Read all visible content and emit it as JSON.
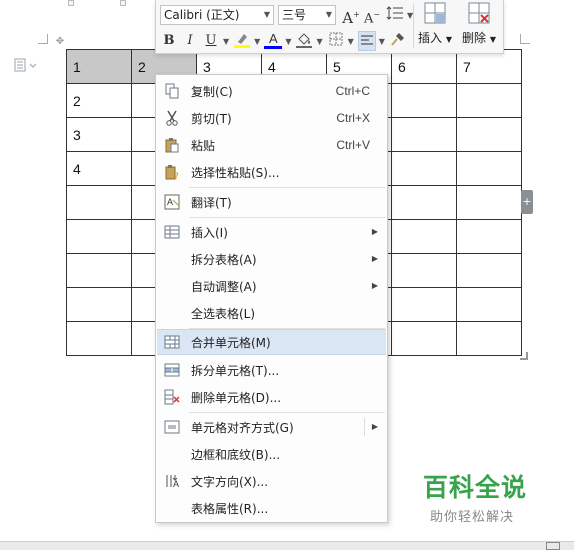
{
  "toolbar": {
    "font_name": "Calibri (正文)",
    "font_size": "三号",
    "grow_font": "A",
    "shrink_font": "A",
    "bold": "B",
    "italic": "I",
    "underline": "U",
    "font_color": "A",
    "insert_label": "插入",
    "delete_label": "删除"
  },
  "table": {
    "rows": [
      [
        "1",
        "2",
        "3",
        "4",
        "5",
        "6",
        "7"
      ],
      [
        "2",
        "",
        "",
        "",
        "",
        "",
        ""
      ],
      [
        "3",
        "",
        "",
        "",
        "",
        "",
        ""
      ],
      [
        "4",
        "",
        "",
        "",
        "",
        "",
        ""
      ],
      [
        "",
        "",
        "",
        "",
        "",
        "",
        ""
      ],
      [
        "",
        "",
        "",
        "",
        "",
        "",
        ""
      ],
      [
        "",
        "",
        "",
        "",
        "",
        "",
        ""
      ],
      [
        "",
        "",
        "",
        "",
        "",
        "",
        ""
      ],
      [
        "",
        "",
        "",
        "",
        "",
        "",
        ""
      ]
    ],
    "selected_cells": "row 1, columns 1–2"
  },
  "context_menu": {
    "items": [
      {
        "label": "复制(C)",
        "shortcut": "Ctrl+C",
        "icon": "copy-icon"
      },
      {
        "label": "剪切(T)",
        "shortcut": "Ctrl+X",
        "icon": "cut-icon"
      },
      {
        "label": "粘贴",
        "shortcut": "Ctrl+V",
        "icon": "paste-icon"
      },
      {
        "label": "选择性粘贴(S)...",
        "shortcut": "",
        "icon": "paste-special-icon"
      },
      {
        "label": "翻译(T)",
        "shortcut": "",
        "icon": "translate-icon"
      },
      {
        "label": "插入(I)",
        "shortcut": "",
        "icon": "insert-table-icon"
      },
      {
        "label": "拆分表格(A)",
        "shortcut": "",
        "icon": ""
      },
      {
        "label": "自动调整(A)",
        "shortcut": "",
        "icon": ""
      },
      {
        "label": "全选表格(L)",
        "shortcut": "",
        "icon": ""
      },
      {
        "label": "合并单元格(M)",
        "shortcut": "",
        "icon": "merge-cells-icon"
      },
      {
        "label": "拆分单元格(T)...",
        "shortcut": "",
        "icon": "split-cells-icon"
      },
      {
        "label": "删除单元格(D)...",
        "shortcut": "",
        "icon": "delete-cells-icon"
      },
      {
        "label": "单元格对齐方式(G)",
        "shortcut": "",
        "icon": "cell-align-icon"
      },
      {
        "label": "边框和底纹(B)...",
        "shortcut": "",
        "icon": ""
      },
      {
        "label": "文字方向(X)...",
        "shortcut": "",
        "icon": "text-direction-icon"
      },
      {
        "label": "表格属性(R)...",
        "shortcut": "",
        "icon": ""
      }
    ],
    "highlighted_item": "合并单元格(M)"
  },
  "watermark": {
    "title": "百科全说",
    "subtitle": "助你轻松解决"
  },
  "colors": {
    "highlight_bg": "#dbe6f5",
    "selected_cell": "#c8c8c8",
    "watermark_green": "#37a34a",
    "font_color_bar": "#0000ff",
    "highlighter_bar": "#ffff00"
  }
}
